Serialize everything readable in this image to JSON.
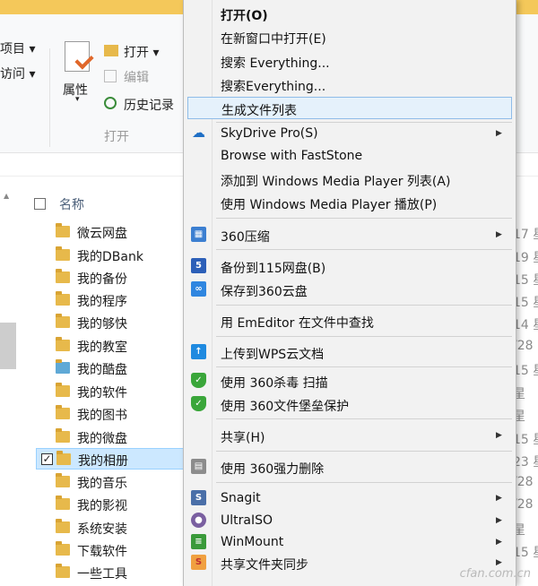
{
  "ribbon": {
    "left_item1": "项目 ▾",
    "left_item2": "访问 ▾",
    "props_label": "属性",
    "open_label": "打开 ▾",
    "edit_label": "编辑",
    "history_label": "历史记录",
    "group_label": "打开"
  },
  "header": {
    "name_label": "名称"
  },
  "files": [
    {
      "name": "微云网盘",
      "date": "17 星"
    },
    {
      "name": "我的DBank",
      "date": "19 星"
    },
    {
      "name": "我的备份",
      "date": "15 星"
    },
    {
      "name": "我的程序",
      "date": "15 星"
    },
    {
      "name": "我的够快",
      "date": "14 星"
    },
    {
      "name": "我的教室",
      "date": "/28"
    },
    {
      "name": "我的酷盘",
      "date": "15 星"
    },
    {
      "name": "我的软件",
      "date": "星"
    },
    {
      "name": "我的图书",
      "date": "星"
    },
    {
      "name": "我的微盘",
      "date": "15 星"
    },
    {
      "name": "我的相册",
      "date": "23 星"
    },
    {
      "name": "我的音乐",
      "date": "/28"
    },
    {
      "name": "我的影视",
      "date": "/28"
    },
    {
      "name": "系统安装",
      "date": "星"
    },
    {
      "name": "下载软件",
      "date": "15 星"
    },
    {
      "name": "一些工具",
      "date": ""
    }
  ],
  "menu": {
    "items": [
      {
        "label": "打开(O)"
      },
      {
        "label": "在新窗口中打开(E)"
      },
      {
        "label": "搜索 Everything..."
      },
      {
        "label": "搜索Everything..."
      },
      {
        "label": "生成文件列表"
      },
      {
        "label": "SkyDrive Pro(S)"
      },
      {
        "label": "Browse with FastStone"
      },
      {
        "label": "添加到 Windows Media Player 列表(A)"
      },
      {
        "label": "使用 Windows Media Player 播放(P)"
      },
      {
        "label": "360压缩"
      },
      {
        "label": "备份到115网盘(B)"
      },
      {
        "label": "保存到360云盘"
      },
      {
        "label": "用 EmEditor 在文件中查找"
      },
      {
        "label": "上传到WPS云文档"
      },
      {
        "label": "使用 360杀毒 扫描"
      },
      {
        "label": "使用 360文件堡垒保护"
      },
      {
        "label": "共享(H)"
      },
      {
        "label": "使用 360强力删除"
      },
      {
        "label": "Snagit"
      },
      {
        "label": "UltraISO"
      },
      {
        "label": "WinMount"
      },
      {
        "label": "共享文件夹同步"
      }
    ]
  },
  "watermark": "cfan.com.cn",
  "colors": {
    "highlight": "#e5f1fb",
    "highlight_border": "#8fbce8",
    "selected_row": "#cce8ff",
    "folder": "#e7b94b"
  }
}
